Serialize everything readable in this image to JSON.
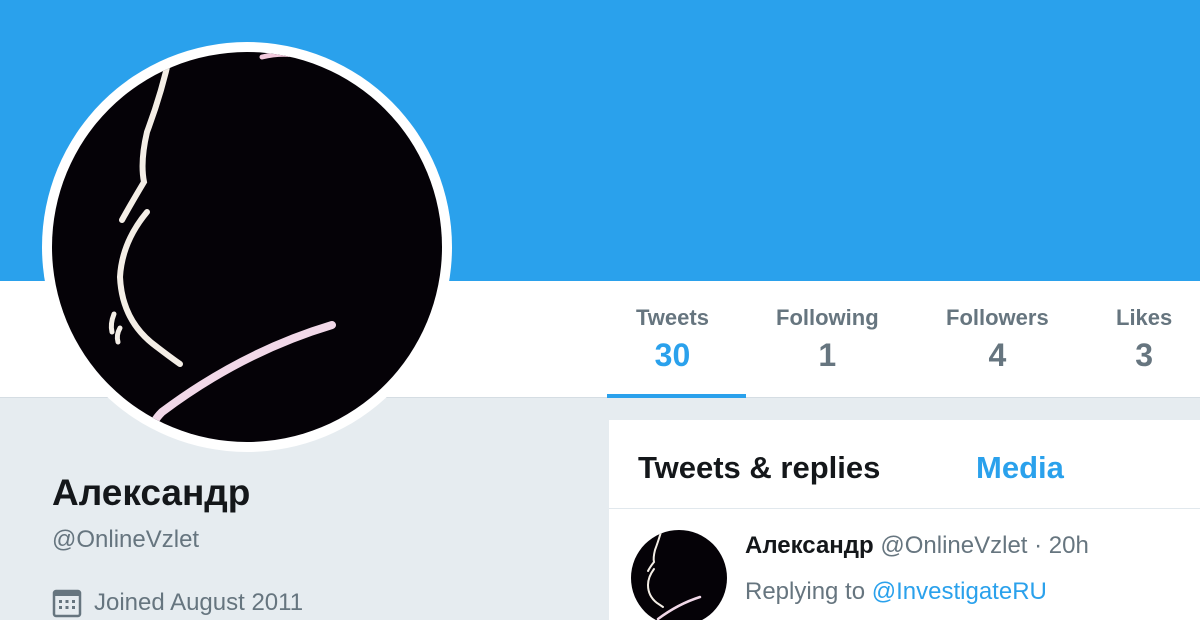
{
  "colors": {
    "accent": "#2aa1ec",
    "banner": "#2aa1ec",
    "text_primary": "#14171a",
    "text_secondary": "#66757f",
    "page_background": "#e6ecf0"
  },
  "profile": {
    "avatar_icon": "silhouette-avatar",
    "name": "Александр",
    "handle": "@OnlineVzlet",
    "joined": "Joined August 2011",
    "joined_icon": "calendar-icon"
  },
  "stats": [
    {
      "label": "Tweets",
      "value": "30",
      "active": true
    },
    {
      "label": "Following",
      "value": "1",
      "active": false
    },
    {
      "label": "Followers",
      "value": "4",
      "active": false
    },
    {
      "label": "Likes",
      "value": "3",
      "active": false
    }
  ],
  "timeline": {
    "tabs": [
      {
        "label": "Tweets & replies",
        "active": false
      },
      {
        "label": "Media",
        "active": true
      }
    ],
    "tweet": {
      "name": "Александр",
      "handle": "@OnlineVzlet",
      "separator": "·",
      "time": "20h",
      "replying_prefix": "Replying to",
      "replying_to": "@InvestigateRU"
    }
  }
}
